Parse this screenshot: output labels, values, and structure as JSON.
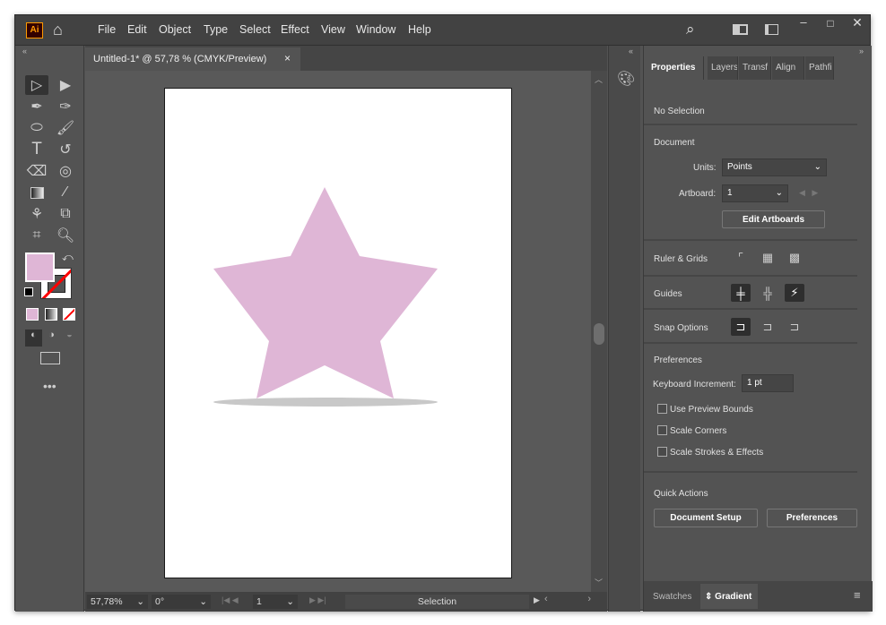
{
  "app": {
    "logo": "Ai"
  },
  "menu": [
    "File",
    "Edit",
    "Object",
    "Type",
    "Select",
    "Effect",
    "View",
    "Window",
    "Help"
  ],
  "document_tab": {
    "title": "Untitled-1* @ 57,78 % (CMYK/Preview)",
    "close": "×"
  },
  "colors": {
    "fill": "#dfb6d6",
    "accent": "#ff0000",
    "star": "#dfb6d6",
    "shadow": "#c8c8c8"
  },
  "status": {
    "zoom": "57,78%",
    "rotation": "0°",
    "artboard": "1",
    "tool": "Selection"
  },
  "panel": {
    "tabs": [
      "Properties",
      "Layers",
      "Transf",
      "Align",
      "Pathfi"
    ],
    "selection": "No Selection",
    "document_header": "Document",
    "units_label": "Units:",
    "units_value": "Points",
    "artboard_label": "Artboard:",
    "artboard_value": "1",
    "edit_artboards": "Edit Artboards",
    "ruler_grids": "Ruler & Grids",
    "guides": "Guides",
    "snap_options": "Snap Options",
    "preferences_header": "Preferences",
    "keyboard_increment_label": "Keyboard Increment:",
    "keyboard_increment_value": "1 pt",
    "checkboxes": [
      "Use Preview Bounds",
      "Scale Corners",
      "Scale Strokes & Effects"
    ],
    "quick_actions": "Quick Actions",
    "document_setup": "Document Setup",
    "preferences_button": "Preferences",
    "bottom_tabs": [
      "Swatches",
      "Gradient"
    ]
  }
}
